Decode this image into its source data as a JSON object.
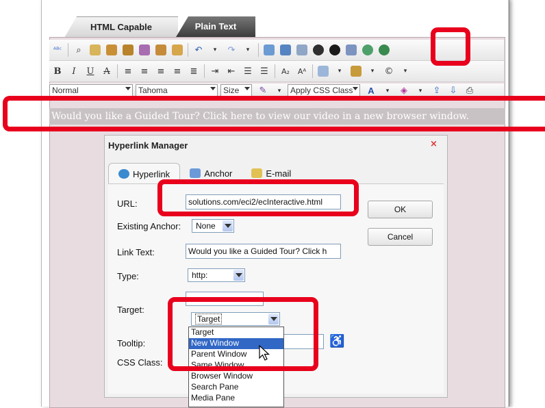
{
  "tabs": {
    "html_capable": "HTML Capable",
    "plain_text": "Plain Text"
  },
  "toolbar3": {
    "font_block": "Normal",
    "font_name": "Tahoma",
    "font_size": "Size",
    "css_class": "Apply CSS Class"
  },
  "content": {
    "link_text": "Would you like a Guided Tour? Click here to view our video in a new browser window."
  },
  "dialog": {
    "title": "Hyperlink Manager",
    "close": "×",
    "tabs": [
      "Hyperlink",
      "Anchor",
      "E-mail"
    ],
    "url_label": "URL:",
    "url_value": "solutions.com/eci2/ecInteractive.html",
    "anchor_label": "Existing Anchor:",
    "anchor_value": "None",
    "linktext_label": "Link Text:",
    "linktext_value": "Would you like a Guided Tour? Click h",
    "type_label": "Type:",
    "type_value": "http:",
    "target_label": "Target:",
    "target_value": "Target",
    "tooltip_label": "Tooltip:",
    "cssclass_label": "CSS Class:",
    "ok": "OK",
    "cancel": "Cancel"
  },
  "target_options": [
    "Target",
    "New Window",
    "Parent Window",
    "Same Window",
    "Browser Window",
    "Search Pane",
    "Media Pane"
  ],
  "target_highlighted": "New Window",
  "colors": {
    "highlight": "#e8001c",
    "selection": "#3167c5",
    "editor_bg": "#e9dce1"
  }
}
